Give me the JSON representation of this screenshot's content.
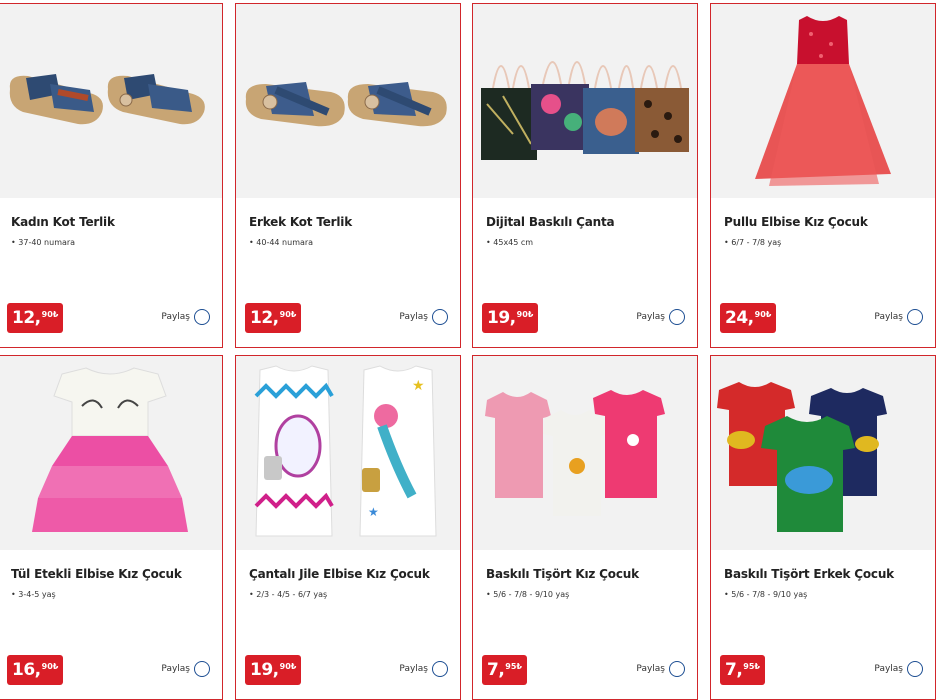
{
  "products": [
    {
      "name": "Kadın Kot Terlik",
      "detail": "• 37-40 numara",
      "price_int": "12,",
      "price_dec": "90₺",
      "share": "Paylaş",
      "image": "sandals-womens"
    },
    {
      "name": "Erkek Kot Terlik",
      "detail": "• 40-44 numara",
      "price_int": "12,",
      "price_dec": "90₺",
      "share": "Paylaş",
      "image": "sandals-mens"
    },
    {
      "name": "Dijital Baskılı Çanta",
      "detail": "• 45x45 cm",
      "price_int": "19,",
      "price_dec": "90₺",
      "share": "Paylaş",
      "image": "tote-bags"
    },
    {
      "name": "Pullu Elbise Kız Çocuk",
      "detail": "• 6/7 - 7/8 yaş",
      "price_int": "24,",
      "price_dec": "90₺",
      "share": "Paylaş",
      "image": "red-sequin-dress"
    },
    {
      "name": "Tül Etekli Elbise Kız Çocuk",
      "detail": "• 3-4-5 yaş",
      "price_int": "16,",
      "price_dec": "90₺",
      "share": "Paylaş",
      "image": "tutu-dress"
    },
    {
      "name": "Çantalı Jile Elbise Kız Çocuk",
      "detail": "• 2/3 - 4/5 - 6/7 yaş",
      "price_int": "19,",
      "price_dec": "90₺",
      "share": "Paylaş",
      "image": "unicorn-dresses"
    },
    {
      "name": "Baskılı Tişört Kız Çocuk",
      "detail": "• 5/6 - 7/8 - 9/10 yaş",
      "price_int": "7,",
      "price_dec": "95₺",
      "share": "Paylaş",
      "image": "girls-tshirts"
    },
    {
      "name": "Baskılı Tişört Erkek Çocuk",
      "detail": "• 5/6 - 7/8 - 9/10 yaş",
      "price_int": "7,",
      "price_dec": "95₺",
      "share": "Paylaş",
      "image": "boys-tshirts"
    }
  ],
  "colors": {
    "border": "#d1262b",
    "price_badge": "#d91e27",
    "share_circle": "#1e4f93"
  }
}
